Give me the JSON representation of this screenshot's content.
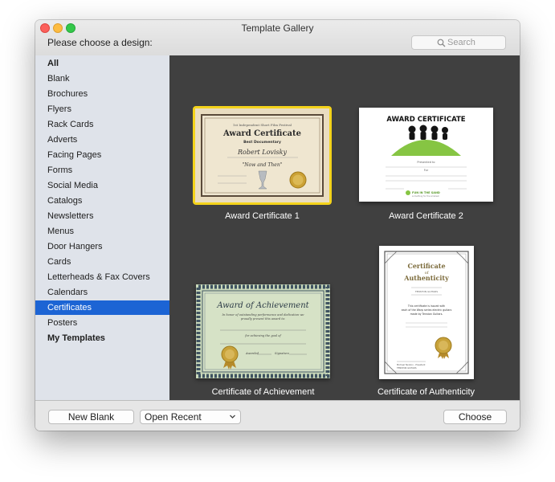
{
  "window": {
    "title": "Template Gallery",
    "prompt": "Please choose a design:",
    "search_placeholder": "Search"
  },
  "sidebar": {
    "items": [
      {
        "label": "All",
        "bold": true
      },
      {
        "label": "Blank"
      },
      {
        "label": "Brochures"
      },
      {
        "label": "Flyers"
      },
      {
        "label": "Rack Cards"
      },
      {
        "label": "Adverts"
      },
      {
        "label": "Facing Pages"
      },
      {
        "label": "Forms"
      },
      {
        "label": "Social Media"
      },
      {
        "label": "Catalogs"
      },
      {
        "label": "Newsletters"
      },
      {
        "label": "Menus"
      },
      {
        "label": "Door Hangers"
      },
      {
        "label": "Cards"
      },
      {
        "label": "Letterheads & Fax Covers"
      },
      {
        "label": "Calendars"
      },
      {
        "label": "Certificates",
        "selected": true
      },
      {
        "label": "Posters"
      },
      {
        "label": "My Templates",
        "bold": true
      }
    ]
  },
  "gallery": {
    "templates": [
      {
        "label": "Award Certificate 1",
        "selected": true,
        "preview": {
          "top_line": "1st Independent Short Film Festival",
          "title": "Award Certificate",
          "subtitle": "Best Documentary",
          "name": "Robert Lovisky",
          "film": "\"Now and Then\""
        }
      },
      {
        "label": "Award Certificate 2",
        "preview": {
          "title": "AWARD CERTIFICATE",
          "presented": "Presented to",
          "for": "For",
          "logo": "FUN IN THE SAND",
          "logo_sub": "something for the smallest"
        }
      },
      {
        "label": "Certificate of Achievement",
        "preview": {
          "title": "Award of Achievement",
          "line1": "In honor of outstanding performance and dedication we",
          "line2": "proudly present this award to:",
          "goal": "for achieving the goal of",
          "awarded": "Awarded",
          "signature": "Signature"
        }
      },
      {
        "label": "Certificate of Authenticity",
        "preview": {
          "title_line1": "Certificate",
          "title_line2": "of",
          "title_line3": "Authenticity",
          "brand": "TENSTON GUITARS",
          "body1": "This certificate is issued with",
          "body2": "each of the Warp series electric guitars",
          "body3": "made by Tenston Guitars.",
          "sig_line": "Michael Tenston - President"
        }
      }
    ]
  },
  "footer": {
    "new_blank": "New Blank",
    "open_recent": "Open Recent",
    "choose": "Choose"
  },
  "colors": {
    "selection_blue": "#1c64d4",
    "gallery_bg": "#404040",
    "thumb_highlight": "#f4d31b",
    "sidebar_bg": "#dfe3ea"
  }
}
